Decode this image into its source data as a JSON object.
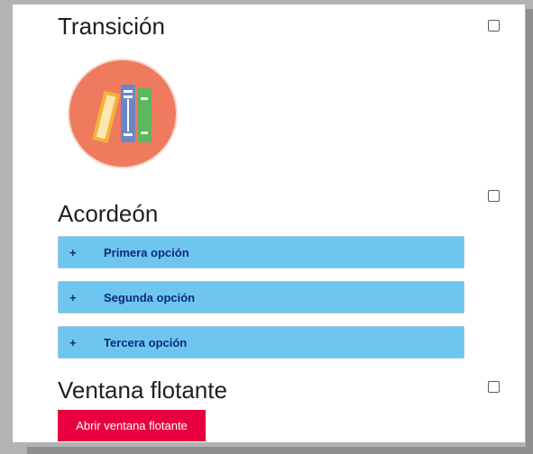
{
  "sections": {
    "transition": {
      "title": "Transición"
    },
    "accordion": {
      "title": "Acordeón",
      "items": [
        {
          "icon": "+",
          "label": "Primera opción"
        },
        {
          "icon": "+",
          "label": "Segunda opción"
        },
        {
          "icon": "+",
          "label": "Tercera opción"
        }
      ]
    },
    "modal": {
      "title": "Ventana flotante",
      "button_label": "Abrir ventana flotante"
    }
  },
  "colors": {
    "accordion_bg": "#6ec6ef",
    "accordion_text": "#0c2a7a",
    "button_bg": "#e8003f",
    "logo_circle": "#ef7a5e"
  },
  "icons": {
    "logo": "books-logo-icon",
    "checkbox": "checkbox-icon"
  }
}
